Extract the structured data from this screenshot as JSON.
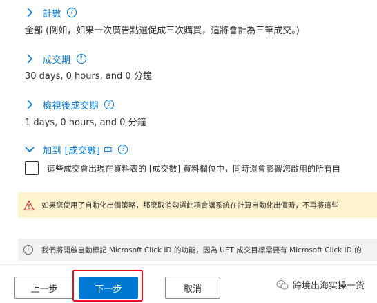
{
  "sections": [
    {
      "title": "計數",
      "value": "全部 (例如，如果一次廣告點選促成三次購買，這將會計為三筆成交。)",
      "expanded": false
    },
    {
      "title": "成交期",
      "value": "30 days, 0 hours, and 0 分鐘",
      "expanded": false
    },
    {
      "title": "檢視後成交期",
      "value": "1 days, 0 hours, and 0 分鐘",
      "expanded": false
    },
    {
      "title": "加到 [成交數] 中",
      "expanded": true
    }
  ],
  "help_glyph": "?",
  "checkbox": {
    "label": "這些成交會出現在資料表的 [成交數] 資料欄位中，同時還會影響您啟用的所有自",
    "checked": false
  },
  "warning": {
    "icon": "warning-triangle-icon",
    "text": "如果您使用了自動化出價策略，那麼取消勾選此項會讓系統在計算自動化出價時，不再將這些"
  },
  "info": {
    "icon": "info-icon",
    "glyph": "i",
    "text": "我們將開啟自動標記 Microsoft Click ID 的功能，因為 UET 成交目標需要有 Microsoft Click ID 的"
  },
  "buttons": {
    "back": "上一步",
    "next": "下一步",
    "cancel": "取消"
  },
  "watermark": {
    "text": "跨境出海实操干货"
  },
  "colors": {
    "accent": "#0078d4",
    "warning_bg": "#fff4ce",
    "warning_icon": "#d13438",
    "info_bg": "#f3f2f1",
    "highlight": "#e81123"
  }
}
